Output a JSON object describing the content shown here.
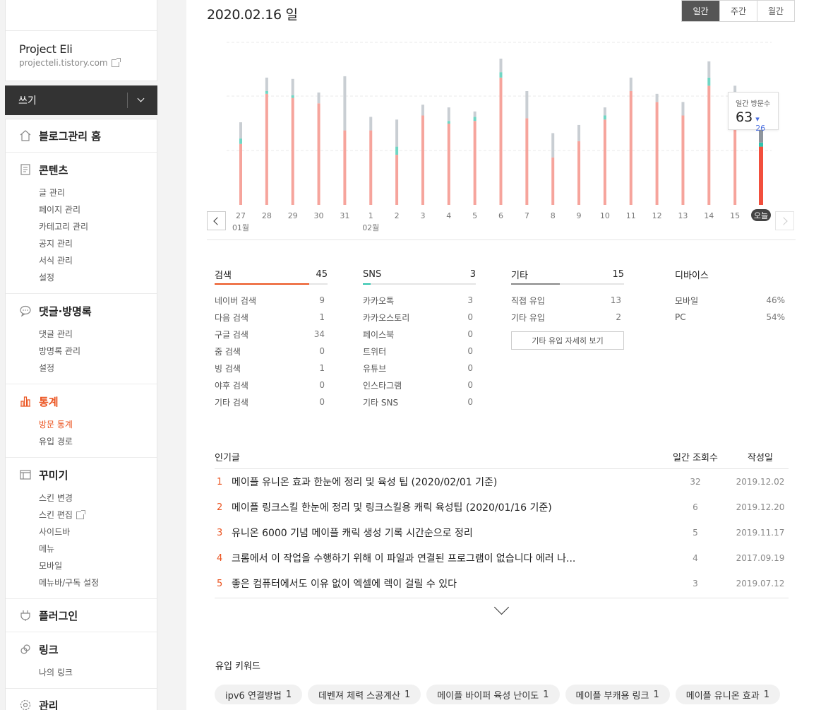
{
  "blog": {
    "name": "Project Eli",
    "url": "projecteli.tistory.com"
  },
  "write": {
    "label": "쓰기"
  },
  "sidebar": {
    "home": "블로그관리 홈",
    "contents": {
      "title": "콘텐츠",
      "items": [
        "글 관리",
        "페이지 관리",
        "카테고리 관리",
        "공지 관리",
        "서식 관리",
        "설정"
      ]
    },
    "comments": {
      "title": "댓글·방명록",
      "items": [
        "댓글 관리",
        "방명록 관리",
        "설정"
      ]
    },
    "stats": {
      "title": "통계",
      "items": [
        "방문 통계",
        "유입 경로"
      ]
    },
    "decorate": {
      "title": "꾸미기",
      "items": [
        "스킨 변경",
        "스킨 편집",
        "사이드바",
        "메뉴",
        "모바일",
        "메뉴바/구독 설정"
      ]
    },
    "plugin": "플러그인",
    "link": {
      "title": "링크",
      "items": [
        "나의 링크"
      ]
    },
    "manage": "관리"
  },
  "header": {
    "date": "2020.02.16 일"
  },
  "period_tabs": [
    "일간",
    "주간",
    "월간"
  ],
  "tooltip": {
    "label": "일간 방문수",
    "value": "63",
    "delta": "26"
  },
  "chart_data": {
    "type": "bar",
    "categories": [
      "27",
      "28",
      "29",
      "30",
      "31",
      "1",
      "2",
      "3",
      "4",
      "5",
      "6",
      "7",
      "8",
      "9",
      "10",
      "11",
      "12",
      "13",
      "14",
      "15",
      "오늘"
    ],
    "month_labels": [
      {
        "at": "27",
        "label": "01월"
      },
      {
        "at": "1",
        "label": "02월"
      }
    ],
    "series": [
      {
        "values": [
          45,
          82,
          79,
          75,
          55,
          55,
          37,
          66,
          60,
          62,
          94,
          64,
          35,
          47,
          63,
          84,
          76,
          66,
          88,
          76,
          43
        ]
      },
      {
        "values": [
          4,
          2,
          2,
          0,
          0,
          0,
          6,
          0,
          2,
          3,
          4,
          0,
          0,
          0,
          3,
          0,
          0,
          0,
          6,
          0,
          3
        ]
      },
      {
        "values": [
          12,
          10,
          12,
          8,
          40,
          10,
          20,
          8,
          10,
          4,
          10,
          20,
          18,
          12,
          6,
          10,
          6,
          10,
          12,
          12,
          17
        ]
      }
    ],
    "colors": [
      "#f6a49c",
      "#70d6c4",
      "#c9ced3"
    ],
    "today_colors": [
      "#f24f3d",
      "#2ec4ad",
      "#8f969e"
    ],
    "ylim": [
      0,
      120
    ]
  },
  "stats": {
    "search": {
      "title": "검색",
      "total": "45",
      "fill": 0.84,
      "color": "#eb531f",
      "rows": [
        [
          "네이버 검색",
          "9"
        ],
        [
          "다음 검색",
          "1"
        ],
        [
          "구글 검색",
          "34"
        ],
        [
          "줌 검색",
          "0"
        ],
        [
          "빙 검색",
          "1"
        ],
        [
          "야후 검색",
          "0"
        ],
        [
          "기타 검색",
          "0"
        ]
      ]
    },
    "sns": {
      "title": "SNS",
      "total": "3",
      "fill": 0.07,
      "color": "#2ec4ad",
      "rows": [
        [
          "카카오톡",
          "3"
        ],
        [
          "카카오스토리",
          "0"
        ],
        [
          "페이스북",
          "0"
        ],
        [
          "트위터",
          "0"
        ],
        [
          "유튜브",
          "0"
        ],
        [
          "인스타그램",
          "0"
        ],
        [
          "기타 SNS",
          "0"
        ]
      ]
    },
    "other": {
      "title": "기타",
      "total": "15",
      "fill": 0.43,
      "color": "#888888",
      "rows": [
        [
          "직접 유입",
          "13"
        ],
        [
          "기타 유입",
          "2"
        ]
      ],
      "button": "기타 유입 자세히 보기"
    },
    "device": {
      "title": "디바이스",
      "rows": [
        [
          "모바일",
          "46%"
        ],
        [
          "PC",
          "54%"
        ]
      ]
    }
  },
  "popular": {
    "headers": [
      "인기글",
      "일간 조회수",
      "작성일"
    ],
    "rows": [
      {
        "rank": "1",
        "title": "메이플 유니온 효과 한눈에 정리 및 육성 팁 (2020/02/01 기준)",
        "views": "32",
        "date": "2019.12.02"
      },
      {
        "rank": "2",
        "title": "메이플 링크스킬 한눈에 정리 및 링크스킬용 캐릭 육성팁 (2020/01/16 기준)",
        "views": "6",
        "date": "2019.12.20"
      },
      {
        "rank": "3",
        "title": "유니온 6000 기념 메이플 캐릭 생성 기록 시간순으로 정리",
        "views": "5",
        "date": "2019.11.17"
      },
      {
        "rank": "4",
        "title": "크롬에서 이 작업을 수행하기 위해 이 파일과 연결된 프로그램이 없습니다 에러 나...",
        "views": "4",
        "date": "2017.09.19"
      },
      {
        "rank": "5",
        "title": "좋은 컴퓨터에서도 이유 없이 엑셀에 렉이 걸릴 수 있다",
        "views": "3",
        "date": "2019.07.12"
      }
    ]
  },
  "keywords": {
    "title": "유입 키워드",
    "items": [
      {
        "text": "ipv6 연결방법",
        "count": "1"
      },
      {
        "text": "데벤져 체력 스공계산",
        "count": "1"
      },
      {
        "text": "메이플 바이퍼 육성 난이도",
        "count": "1"
      },
      {
        "text": "메이플 부캐용 링크",
        "count": "1"
      },
      {
        "text": "메이플 유니온 효과",
        "count": "1"
      }
    ]
  }
}
